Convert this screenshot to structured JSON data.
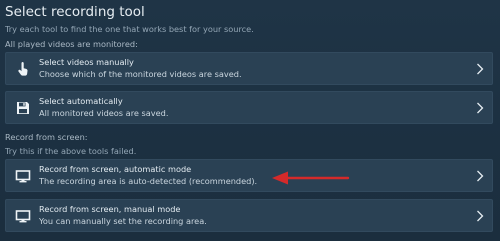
{
  "header": {
    "title": "Select recording tool",
    "subtitle": "Try each tool to find the one that works best for your source."
  },
  "monitored_section": {
    "label": "All  played videos are monitored:",
    "options": [
      {
        "title": "Select videos manually",
        "description": "Choose which of the monitored videos are saved.",
        "icon": "hand-pointer-icon"
      },
      {
        "title": "Select automatically",
        "description": "All monitored videos are saved.",
        "icon": "floppy-disk-icon"
      }
    ]
  },
  "screen_section": {
    "label": "Record from screen:",
    "hint": "Try this if the above tools failed.",
    "options": [
      {
        "title": "Record from screen, automatic mode",
        "description": "The recording area is auto-detected (recommended).",
        "icon": "monitor-icon"
      },
      {
        "title": "Record from screen, manual mode",
        "description": "You can manually set the recording area.",
        "icon": "monitor-icon"
      }
    ]
  },
  "annotation": {
    "arrow_color": "#d42a2a",
    "arrow_target": "Record from screen, automatic mode"
  },
  "colors": {
    "background": "#1d3142",
    "card": "#2a4154",
    "text": "#e3ebf1",
    "muted": "#93a6b5"
  }
}
